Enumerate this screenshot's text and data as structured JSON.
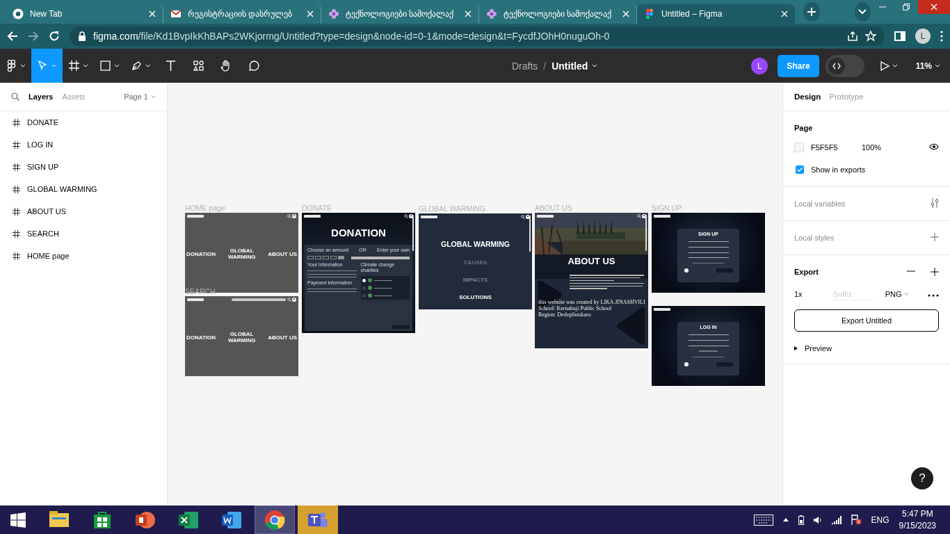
{
  "browser": {
    "tabs": [
      {
        "title": "New Tab",
        "kind": "chrome",
        "selected": false
      },
      {
        "title": "რეგისტრაციის დასრულებ",
        "kind": "mail",
        "selected": false
      },
      {
        "title": "ტექნოლოგიები სამოქალაქ",
        "kind": "flower",
        "selected": false
      },
      {
        "title": "ტექნოლოგიები სამოქალაქ",
        "kind": "flower",
        "selected": false
      },
      {
        "title": "Untitled – Figma",
        "kind": "figma",
        "selected": true
      }
    ],
    "url": {
      "domain": "figma.com",
      "path": "/file/Kd1BvpIkKhBAPs2WKjormg/Untitled?type=design&node-id=0-1&mode=design&t=FycdfJOhH0nuguOh-0"
    },
    "profile": "L"
  },
  "toolbar": {
    "tools": [
      {
        "kind": "menu",
        "selected": false
      },
      {
        "kind": "move",
        "selected": true
      },
      {
        "kind": "frame",
        "selected": false
      },
      {
        "kind": "shape",
        "selected": false
      },
      {
        "kind": "pen",
        "selected": false
      },
      {
        "kind": "text",
        "selected": false
      },
      {
        "kind": "resources",
        "selected": false
      },
      {
        "kind": "hand",
        "selected": false
      },
      {
        "kind": "comment",
        "selected": false
      }
    ],
    "breadcrumb": {
      "folder": "Drafts",
      "separator": "/",
      "file": "Untitled"
    },
    "avatar": "L",
    "share": "Share",
    "dev_mode": false,
    "zoom": "11%"
  },
  "layers_panel": {
    "tabs": [
      {
        "label": "Layers",
        "selected": true
      },
      {
        "label": "Assets",
        "selected": false
      }
    ],
    "page": "Page 1",
    "layers": [
      "DONATE",
      "LOG IN",
      "SIGN UP",
      "GLOBAL WARMING",
      "ABOUT US",
      "SEARCH",
      "HOME page"
    ]
  },
  "canvas": {
    "frames": [
      {
        "kind": "home",
        "label": "HOME page",
        "links": [
          "DONATION",
          "GLOBAL WARMING",
          "ABOUT US"
        ]
      },
      {
        "kind": "search",
        "label": "SEARCH",
        "links": [
          "DONATION",
          "GLOBAL WARMING",
          "ABOUT US"
        ]
      },
      {
        "kind": "donate",
        "label": "DONATE",
        "title": "DONATION",
        "amount_label": "Choose an amount",
        "or": "OR",
        "own_label": "Enter your own",
        "info_heading": "Your information",
        "payment_heading": "Payment information",
        "charities_heading": "Climate change charities",
        "charities": [
          {
            "selected": true
          },
          {
            "selected": false
          },
          {
            "selected": false
          }
        ]
      },
      {
        "kind": "global",
        "label": "GLOBAL WARMING",
        "title": "GLOBAL WARMING",
        "links": [
          {
            "label": "CAUSES",
            "color": "#6b7488"
          },
          {
            "label": "IMPACTS",
            "color": "#80858e"
          },
          {
            "label": "SOLUTIONS",
            "color": "#ffffff"
          }
        ]
      },
      {
        "kind": "about",
        "label": "ABOUT US",
        "title": "ABOUT US",
        "credits": [
          "this website was created by LIKA JINASHVILI",
          "School: Kernabuji Public School",
          "Region: Dedoplistskaro"
        ]
      },
      {
        "kind": "signup",
        "label": "SIGN UP",
        "title": "SIGN UP"
      },
      {
        "kind": "login",
        "title": "LOG IN"
      }
    ],
    "help": "?"
  },
  "design_panel": {
    "tabs": [
      {
        "label": "Design",
        "selected": true
      },
      {
        "label": "Prototype",
        "selected": false
      }
    ],
    "page": {
      "heading": "Page",
      "color": "F5F5F5",
      "opacity": "100%",
      "show_in_exports": {
        "label": "Show in exports",
        "checked": true
      }
    },
    "local_variables": "Local variables",
    "local_styles": "Local styles",
    "export": {
      "heading": "Export",
      "scale": "1x",
      "suffix_placeholder": "Suffix",
      "format": "PNG",
      "button": "Export Untitled",
      "preview": {
        "label": "Preview",
        "expanded": false
      }
    }
  },
  "taskbar": {
    "apps": [
      {
        "kind": "explorer",
        "selected": false,
        "flashing": false
      },
      {
        "kind": "store",
        "selected": false,
        "flashing": false
      },
      {
        "kind": "powerpoint",
        "selected": false,
        "flashing": false
      },
      {
        "kind": "excel",
        "selected": false,
        "flashing": false
      },
      {
        "kind": "word",
        "selected": false,
        "flashing": false
      },
      {
        "kind": "chrome",
        "selected": true,
        "flashing": false
      },
      {
        "kind": "teams",
        "selected": false,
        "flashing": true
      }
    ],
    "language": "ENG",
    "time": "5:47 PM",
    "date": "9/15/2023"
  }
}
